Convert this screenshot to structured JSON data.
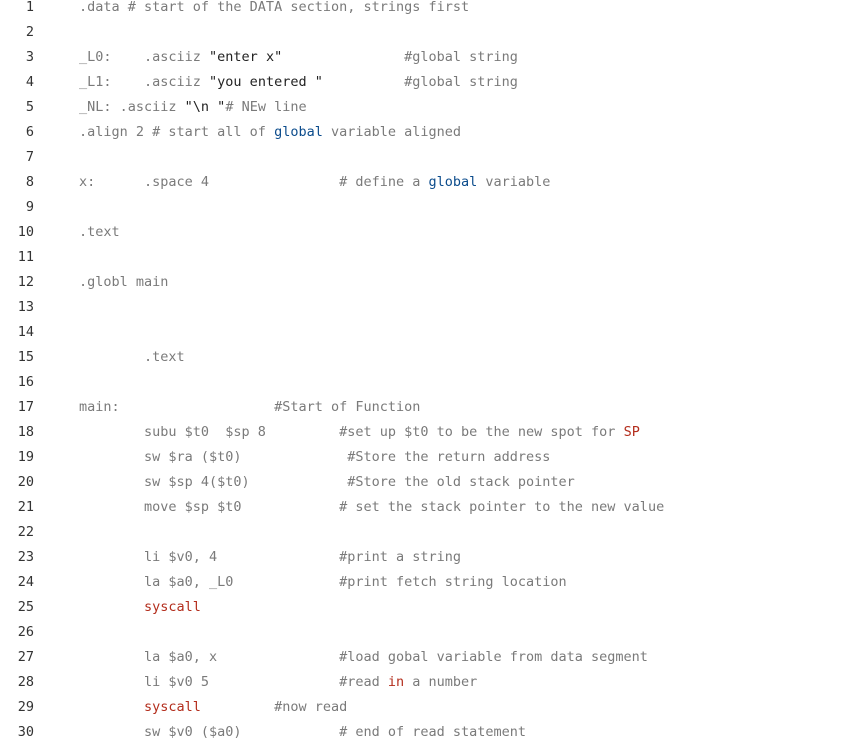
{
  "lines": [
    {
      "n": "1",
      "segs": [
        {
          "t": ".data # start of the DATA section, strings first"
        }
      ]
    },
    {
      "n": "2",
      "segs": []
    },
    {
      "n": "3",
      "segs": [
        {
          "t": "_L0:    .asciiz "
        },
        {
          "t": "\"enter x\"",
          "c": "str"
        },
        {
          "t": "               #global string"
        }
      ]
    },
    {
      "n": "4",
      "segs": [
        {
          "t": "_L1:    .asciiz "
        },
        {
          "t": "\"you entered \"",
          "c": "str"
        },
        {
          "t": "          #global string"
        }
      ]
    },
    {
      "n": "5",
      "segs": [
        {
          "t": "_NL: .asciiz "
        },
        {
          "t": "\"\\n \"",
          "c": "str"
        },
        {
          "t": "# NEw line"
        }
      ]
    },
    {
      "n": "6",
      "segs": [
        {
          "t": ".align 2 # start all of "
        },
        {
          "t": "global",
          "c": "id"
        },
        {
          "t": " variable aligned"
        }
      ]
    },
    {
      "n": "7",
      "segs": []
    },
    {
      "n": "8",
      "segs": [
        {
          "t": "x:      .space 4                # define a "
        },
        {
          "t": "global",
          "c": "id"
        },
        {
          "t": " variable"
        }
      ]
    },
    {
      "n": "9",
      "segs": []
    },
    {
      "n": "10",
      "segs": [
        {
          "t": ".text"
        }
      ]
    },
    {
      "n": "11",
      "segs": []
    },
    {
      "n": "12",
      "segs": [
        {
          "t": ".globl main"
        }
      ]
    },
    {
      "n": "13",
      "segs": []
    },
    {
      "n": "14",
      "segs": []
    },
    {
      "n": "15",
      "segs": [
        {
          "t": "        .text"
        }
      ]
    },
    {
      "n": "16",
      "segs": []
    },
    {
      "n": "17",
      "segs": [
        {
          "t": "main:                   #Start of Function"
        }
      ]
    },
    {
      "n": "18",
      "segs": [
        {
          "t": "        subu $t0  $sp 8         #set up $t0 to be the new spot for "
        },
        {
          "t": "SP",
          "c": "kw"
        }
      ]
    },
    {
      "n": "19",
      "segs": [
        {
          "t": "        sw $ra ($t0)             #Store the return address"
        }
      ]
    },
    {
      "n": "20",
      "segs": [
        {
          "t": "        sw $sp 4($t0)            #Store the old stack pointer"
        }
      ]
    },
    {
      "n": "21",
      "segs": [
        {
          "t": "        move $sp $t0            # set the stack pointer to the new value"
        }
      ]
    },
    {
      "n": "22",
      "segs": []
    },
    {
      "n": "23",
      "segs": [
        {
          "t": "        li $v0, 4               #print a string"
        }
      ]
    },
    {
      "n": "24",
      "segs": [
        {
          "t": "        la $a0, _L0             #print fetch string location"
        }
      ]
    },
    {
      "n": "25",
      "segs": [
        {
          "t": "        "
        },
        {
          "t": "syscall",
          "c": "kw"
        }
      ]
    },
    {
      "n": "26",
      "segs": []
    },
    {
      "n": "27",
      "segs": [
        {
          "t": "        la $a0, x               #load gobal variable from data segment"
        }
      ]
    },
    {
      "n": "28",
      "segs": [
        {
          "t": "        li $v0 5                #read "
        },
        {
          "t": "in",
          "c": "kw"
        },
        {
          "t": " a number"
        }
      ]
    },
    {
      "n": "29",
      "segs": [
        {
          "t": "        "
        },
        {
          "t": "syscall",
          "c": "kw"
        },
        {
          "t": "         #now read"
        }
      ]
    },
    {
      "n": "30",
      "segs": [
        {
          "t": "        sw $v0 ($a0)            # end of read statement"
        }
      ]
    }
  ],
  "colors": {
    "background": "#ffffff",
    "line_number": "#333333",
    "plain": "#7a7a7a",
    "string": "#222222",
    "keyword": "#b32d1c",
    "identifier": "#0c4c8c"
  }
}
